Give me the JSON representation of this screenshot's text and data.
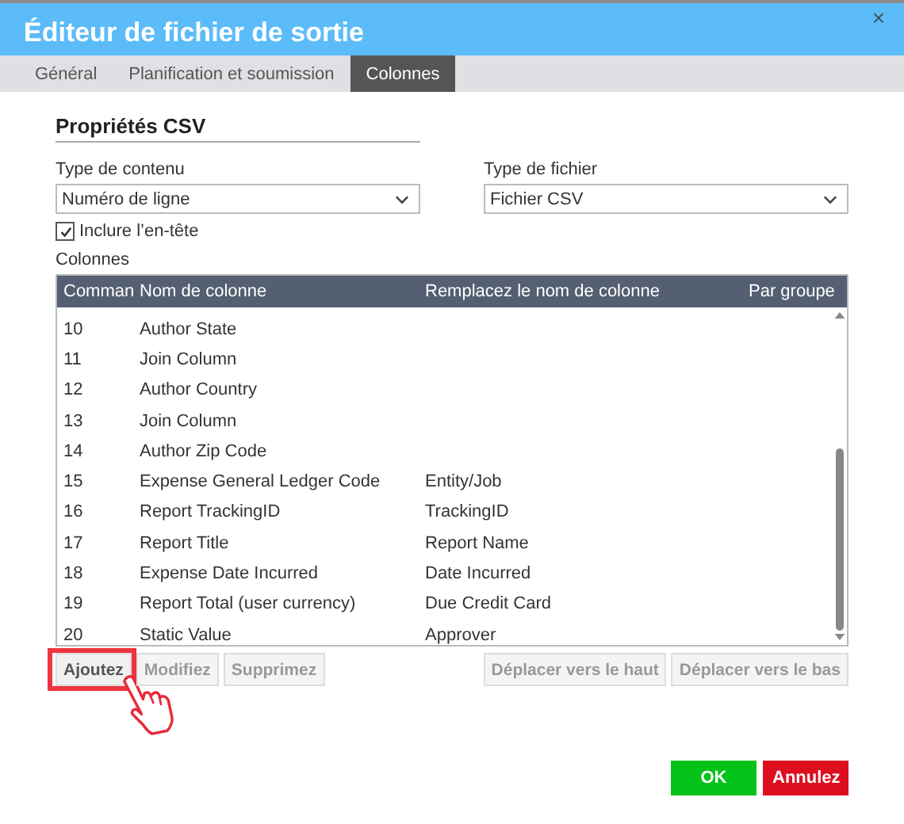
{
  "window": {
    "title": "Éditeur de fichier de sortie",
    "close": "×"
  },
  "tabs": [
    {
      "label": "Général",
      "selected": false
    },
    {
      "label": "Planification et soumission",
      "selected": false
    },
    {
      "label": "Colonnes",
      "selected": true
    }
  ],
  "section_title": "Propriétés CSV",
  "fields": [
    {
      "label": "Type de contenu",
      "value": "Numéro de ligne"
    },
    {
      "label": "Type de fichier",
      "value": "Fichier CSV"
    }
  ],
  "include_header": {
    "label": "Inclure l’en-tête",
    "checked": true
  },
  "table": {
    "label": "Colonnes",
    "columns": [
      "Comman",
      "Nom de colonne",
      "Remplacez le nom de colonne",
      "Par groupe"
    ],
    "rows": [
      [
        "10",
        "Author State",
        ""
      ],
      [
        "11",
        "Join Column",
        ""
      ],
      [
        "12",
        "Author Country",
        ""
      ],
      [
        "13",
        "Join Column",
        ""
      ],
      [
        "14",
        "Author Zip Code",
        ""
      ],
      [
        "15",
        "Expense General Ledger Code",
        "Entity/Job"
      ],
      [
        "16",
        "Report TrackingID",
        "TrackingID"
      ],
      [
        "17",
        "Report Title",
        "Report Name"
      ],
      [
        "18",
        "Expense Date Incurred",
        "Date Incurred"
      ],
      [
        "19",
        "Report Total (user currency)",
        "Due Credit Card"
      ],
      [
        "20",
        "Static Value",
        "Approver"
      ]
    ]
  },
  "row_buttons": [
    {
      "label": "Ajoutez",
      "disabled": false,
      "highlighted": true
    },
    {
      "label": "Modifiez",
      "disabled": true,
      "highlighted": false
    },
    {
      "label": "Supprimez",
      "disabled": true,
      "highlighted": false
    }
  ],
  "move_buttons": [
    {
      "label": "Déplacer vers le haut",
      "disabled": true
    },
    {
      "label": "Déplacer vers le bas",
      "disabled": true
    }
  ],
  "footer_buttons": [
    {
      "label": "OK",
      "kind": "confirm"
    },
    {
      "label": "Annulez",
      "kind": "cancel"
    }
  ]
}
